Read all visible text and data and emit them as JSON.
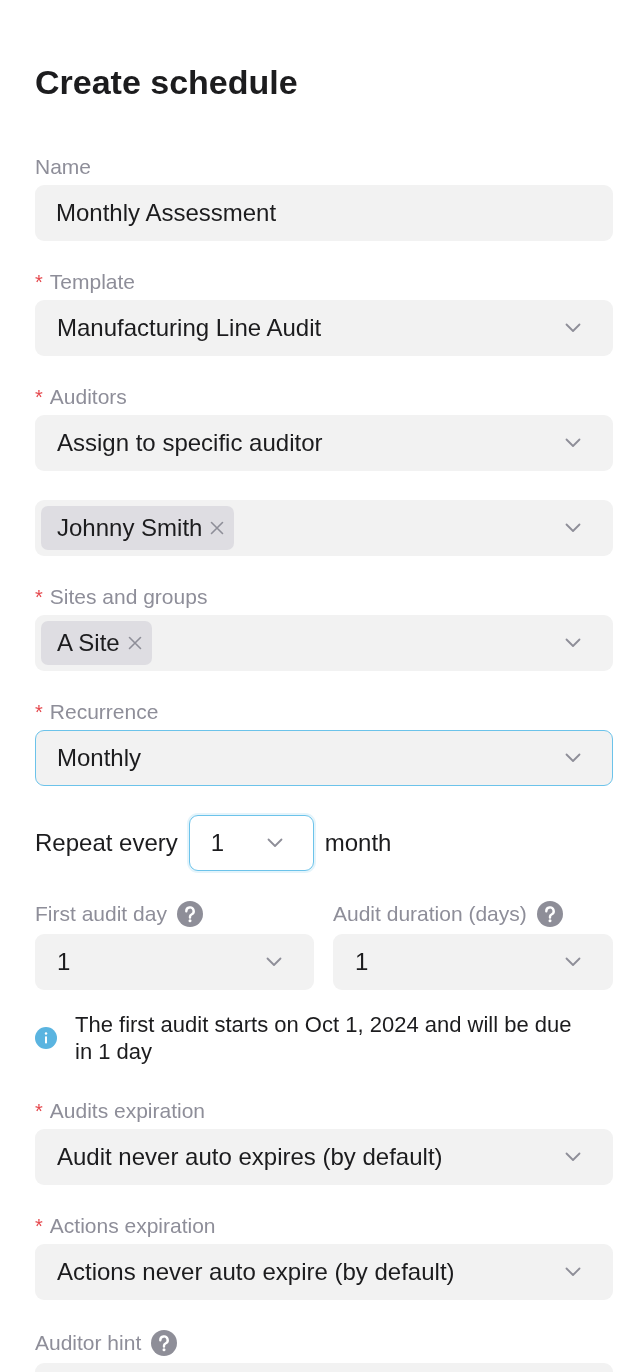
{
  "title": "Create schedule",
  "fields": [
    {
      "kind": "text",
      "label": "Name",
      "value": "Monthly Assessment",
      "focused": false
    },
    {
      "kind": "select",
      "required_mark": "*",
      "label": "Template",
      "value": "Manufacturing Line Audit",
      "focused": false
    },
    {
      "kind": "select",
      "required_mark": "*",
      "label": "Auditors",
      "value": "Assign to specific auditor",
      "focused": false
    },
    {
      "kind": "tags",
      "tags": [
        "Johnny Smith"
      ],
      "focused": false
    },
    {
      "kind": "tags",
      "required_mark": "*",
      "label": "Sites and groups",
      "tags": [
        "A Site"
      ],
      "focused": false
    },
    {
      "kind": "select",
      "required_mark": "*",
      "label": "Recurrence",
      "value": "Monthly",
      "focused": true
    },
    {
      "kind": "repeat",
      "prefix": "Repeat every",
      "value": "1",
      "suffix": "month",
      "focused": true
    },
    {
      "kind": "pair",
      "items": [
        {
          "label": "First audit day",
          "help": true,
          "value": "1",
          "focused": false
        },
        {
          "label": "Audit duration (days)",
          "help": true,
          "value": "1",
          "focused": false
        }
      ]
    },
    {
      "kind": "info",
      "text": "The first audit starts on Oct 1, 2024 and will be due in 1 day"
    },
    {
      "kind": "select",
      "required_mark": "*",
      "label": "Audits expiration",
      "value": "Audit never auto expires (by default)",
      "focused": false
    },
    {
      "kind": "select",
      "required_mark": "*",
      "label": "Actions expiration",
      "value": "Actions never auto expire (by default)",
      "focused": false
    },
    {
      "kind": "textarea",
      "label": "Auditor hint",
      "help": true,
      "focused": false
    }
  ]
}
